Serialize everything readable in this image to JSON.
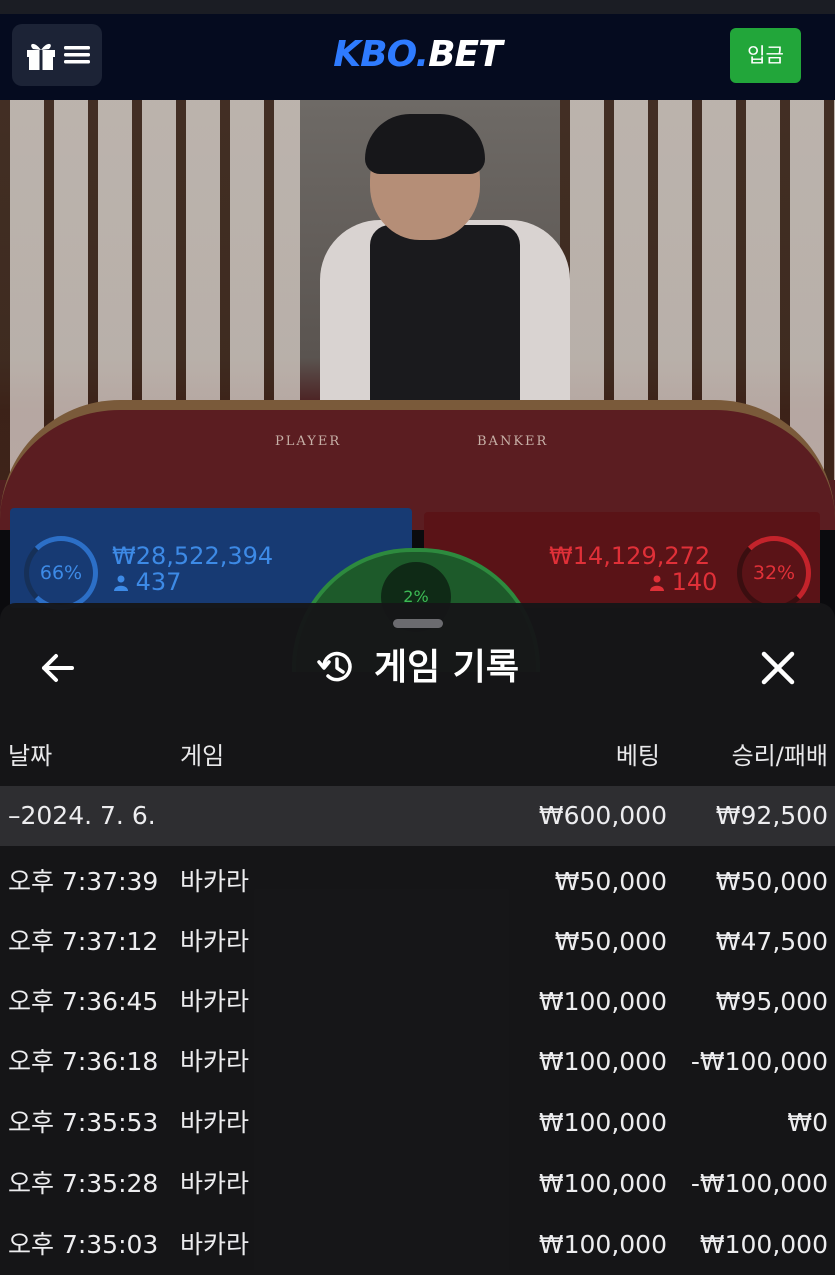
{
  "header": {
    "logo_main": "KBO.",
    "logo_suffix": "BET",
    "deposit_label": "입금"
  },
  "video": {
    "felt_player": "PLAYER",
    "felt_banker": "BANKER"
  },
  "bets": {
    "player": {
      "percent": "66%",
      "amount": "₩28,522,394",
      "count": "437",
      "color": "#3d8ae6"
    },
    "banker": {
      "percent": "32%",
      "amount": "₩14,129,272",
      "count": "140",
      "color": "#e03038"
    },
    "tie": {
      "percent": "2%"
    }
  },
  "sheet": {
    "title": "게임 기록",
    "columns": {
      "date": "날짜",
      "game": "게임",
      "bet": "베팅",
      "result": "승리/패배"
    },
    "group": {
      "date": "–2024. 7. 6.",
      "bet": "₩600,000",
      "result": "₩92,500"
    },
    "rows": [
      {
        "time": "오후 7:37:39",
        "game": "바카라",
        "bet": "₩50,000",
        "result": "₩50,000"
      },
      {
        "time": "오후 7:37:12",
        "game": "바카라",
        "bet": "₩50,000",
        "result": "₩47,500"
      },
      {
        "time": "오후 7:36:45",
        "game": "바카라",
        "bet": "₩100,000",
        "result": "₩95,000"
      },
      {
        "time": "오후 7:36:18",
        "game": "바카라",
        "bet": "₩100,000",
        "result": "-₩100,000"
      },
      {
        "time": "오후 7:35:53",
        "game": "바카라",
        "bet": "₩100,000",
        "result": "₩0"
      },
      {
        "time": "오후 7:35:28",
        "game": "바카라",
        "bet": "₩100,000",
        "result": "-₩100,000"
      },
      {
        "time": "오후 7:35:03",
        "game": "바카라",
        "bet": "₩100,000",
        "result": "₩100,000"
      }
    ]
  },
  "icons": {
    "menu": "gift-menu-icon",
    "back": "arrow-left-icon",
    "history": "history-icon",
    "close": "close-icon"
  },
  "colors": {
    "header_bg": "#050b1f",
    "deposit": "#22a63a",
    "brand_blue": "#2e7bff"
  }
}
